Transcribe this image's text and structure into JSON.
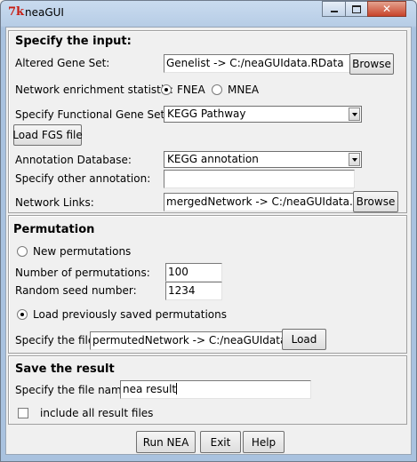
{
  "window": {
    "title": "neaGUI",
    "app_icon": "7k",
    "controls": [
      "minimize-icon",
      "maximize-icon",
      "close-icon"
    ]
  },
  "input": {
    "heading": "Specify the input:",
    "altered_gene_set": {
      "label": "Altered Gene Set:",
      "value": "Genelist -> C:/neaGUIdata.RData",
      "browse": "Browse"
    },
    "statistic": {
      "label": "Network enrichment statistic:",
      "options": [
        "FNEA",
        "MNEA"
      ],
      "selected": "FNEA"
    },
    "fgs": {
      "label": "Specify Functional Gene Set:",
      "selected": "KEGG Pathway",
      "load_button": "Load FGS file"
    },
    "annotation_db": {
      "label": "Annotation Database:",
      "selected": "KEGG annotation"
    },
    "other_annotation": {
      "label": "Specify other annotation:",
      "value": ""
    },
    "network_links": {
      "label": "Network Links:",
      "value": "mergedNetwork -> C:/neaGUIdata.RDat",
      "browse": "Browse"
    }
  },
  "permutation": {
    "heading": "Permutation",
    "new_label": "New permutations",
    "num_label": "Number of permutations:",
    "num_value": "100",
    "seed_label": "Random seed number:",
    "seed_value": "1234",
    "load_label": "Load previously saved permutations",
    "selected": "load",
    "file_label": "Specify the file:",
    "file_value": "permutedNetwork -> C:/neaGUIdata.RD",
    "load_button": "Load"
  },
  "save": {
    "heading": "Save the result",
    "file_label": "Specify the file name:",
    "file_value": "nea result",
    "include_label": "include all result files",
    "include_checked": false
  },
  "actions": {
    "run": "Run NEA",
    "exit": "Exit",
    "help": "Help"
  }
}
